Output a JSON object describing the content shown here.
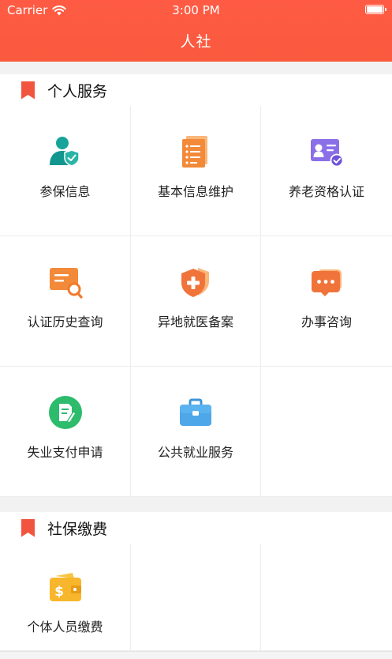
{
  "status_bar": {
    "carrier": "Carrier",
    "time": "3:00 PM"
  },
  "nav": {
    "title": "人社"
  },
  "accent_color": "#fa5a3e",
  "sections": [
    {
      "title": "个人服务",
      "items": [
        {
          "label": "参保信息",
          "icon": "person-shield-icon"
        },
        {
          "label": "基本信息维护",
          "icon": "document-list-icon"
        },
        {
          "label": "养老资格认证",
          "icon": "id-card-check-icon"
        },
        {
          "label": "认证历史查询",
          "icon": "card-search-icon"
        },
        {
          "label": "异地就医备案",
          "icon": "medical-shield-icon"
        },
        {
          "label": "办事咨询",
          "icon": "chat-bubble-icon"
        },
        {
          "label": "失业支付申请",
          "icon": "edit-document-icon"
        },
        {
          "label": "公共就业服务",
          "icon": "briefcase-icon"
        }
      ]
    },
    {
      "title": "社保缴费",
      "items": [
        {
          "label": "个体人员缴费",
          "icon": "wallet-dollar-icon"
        }
      ]
    }
  ]
}
